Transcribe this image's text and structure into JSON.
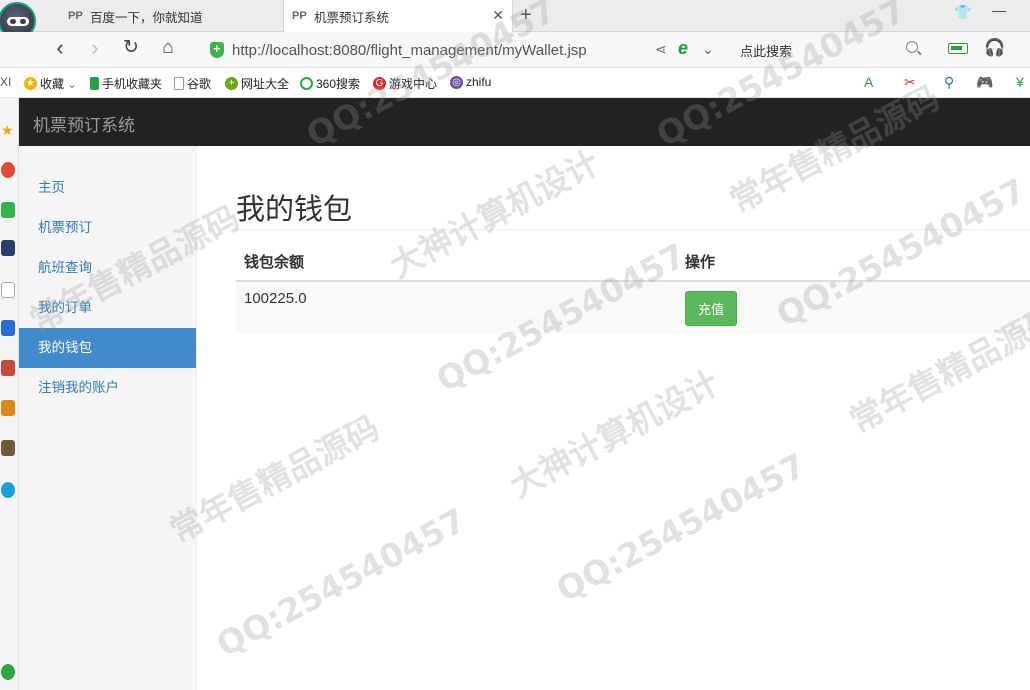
{
  "browser": {
    "tabs": [
      {
        "title": "百度一下，你就知道"
      },
      {
        "title": "机票预订系统"
      }
    ],
    "url_host": "http://localhost",
    "url_rest": ":8080/flight_management/myWallet.jsp",
    "search_placeholder": "点此搜索",
    "bookmarks": [
      "收藏",
      "手机收藏夹",
      "谷歌",
      "网址大全",
      "360搜索",
      "游戏中心",
      "zhifu"
    ]
  },
  "app": {
    "brand": "机票预订系统",
    "sidebar": [
      {
        "label": "主页"
      },
      {
        "label": "机票预订"
      },
      {
        "label": "航班查询"
      },
      {
        "label": "我的订单"
      },
      {
        "label": "我的钱包",
        "active": true
      },
      {
        "label": "注销我的账户"
      }
    ],
    "page_title": "我的钱包",
    "table": {
      "headers": [
        "钱包余额",
        "操作"
      ],
      "balance": "100225.0",
      "action_label": "充值"
    }
  },
  "watermark": {
    "lines": [
      "QQ:254540457",
      "大神计算机设计",
      "常年售精品源码"
    ]
  },
  "colors": {
    "navbar": "#222222",
    "active_nav": "#428bca",
    "link": "#337ab7",
    "success_button": "#5cb85c"
  }
}
